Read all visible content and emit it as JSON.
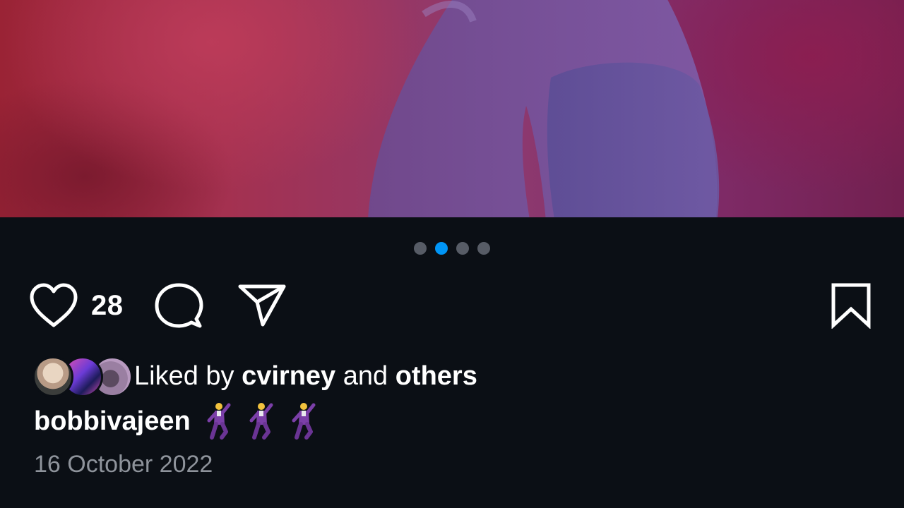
{
  "post": {
    "media": {
      "image_name": "photo-image",
      "pagination": {
        "count": 4,
        "active_index": 1
      }
    },
    "actions": {
      "like_icon": "heart-icon",
      "like_count": "28",
      "comment_icon": "comment-bubble-icon",
      "share_icon": "paper-plane-icon",
      "save_icon": "bookmark-icon"
    },
    "likes": {
      "prefix": "Liked by ",
      "user": "cvirney",
      "middle": " and ",
      "others": "others"
    },
    "caption": {
      "username": "bobbivajeen",
      "emoji": [
        "🕺",
        "🕺",
        "🕺"
      ]
    },
    "date": "16 October 2022"
  },
  "colors": {
    "background": "#0b0f15",
    "active_dot": "#0095f6",
    "inactive_dot": "#575c66",
    "date_text": "#8e939b"
  }
}
